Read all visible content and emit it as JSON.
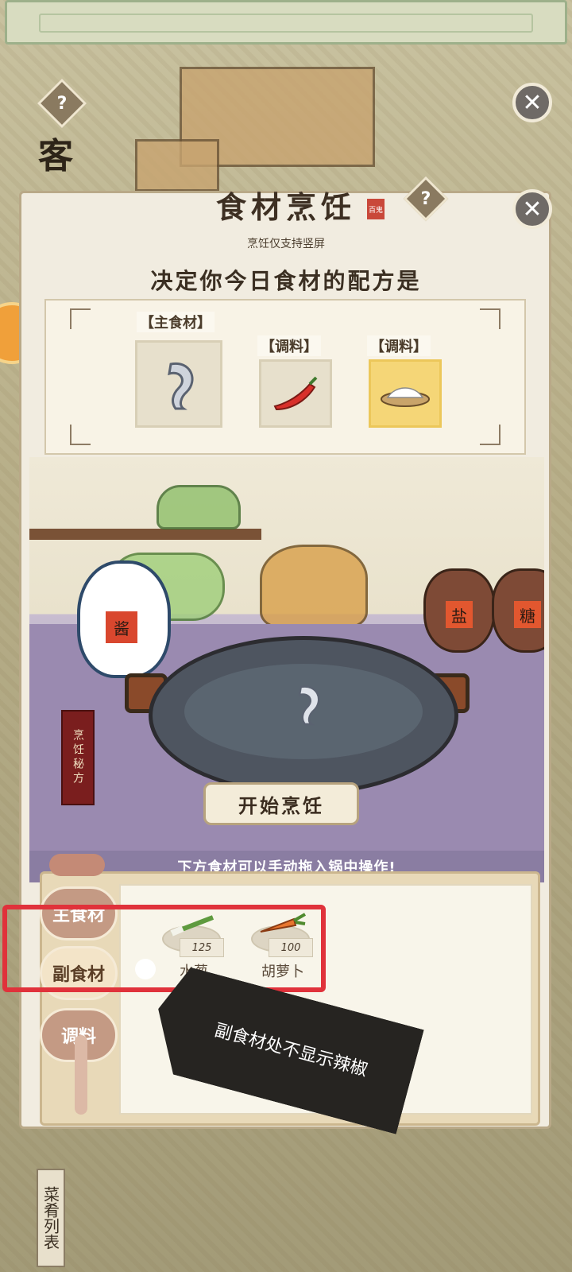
{
  "background": {
    "side_char": "客"
  },
  "modal": {
    "title": "食材烹饪",
    "seal": "百鬼",
    "subtitle": "烹饪仅支持竖屏",
    "heading": "决定你今日食材的配方是"
  },
  "recipe_slots": [
    {
      "label": "【主食材】",
      "icon": "shrimp-icon",
      "selected": false
    },
    {
      "label": "【调料】",
      "icon": "chili-pepper-icon",
      "selected": false
    },
    {
      "label": "【调料】",
      "icon": "salt-icon",
      "selected": true
    }
  ],
  "kitchen": {
    "teapot_label": "酱",
    "jar_labels": [
      "盐",
      "糖"
    ],
    "secret_recipe_label": "烹饪秘方",
    "cook_button": "开始烹饪",
    "hint": "下方食材可以手动拖入锅中操作!"
  },
  "tabs": [
    {
      "label": "主食材",
      "active": false
    },
    {
      "label": "副食材",
      "active": true
    },
    {
      "label": "调料",
      "active": false
    }
  ],
  "ingredients": [
    {
      "name": "水葱",
      "count": "125",
      "icon": "scallion-icon"
    },
    {
      "name": "胡萝卜",
      "count": "100",
      "icon": "carrot-icon"
    }
  ],
  "annotation": "副食材处不显示辣椒",
  "bottom_side_label": "菜肴列表",
  "colors": {
    "highlight": "#e0323b",
    "selected_slot": "#f5d677",
    "annotation_bg": "#262421"
  }
}
